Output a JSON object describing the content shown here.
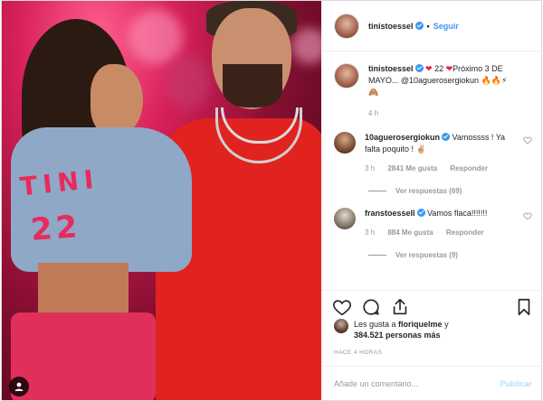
{
  "post": {
    "author": "tinistoessel",
    "follow_label": "Seguir",
    "separator": "•"
  },
  "caption": {
    "username": "tinistoessel",
    "text_before": " 22 ",
    "text_after": "Próximo 3 DE MAYO... @10aguerosergiokun 🔥🔥⚡",
    "emoji_line": "🙈",
    "time": "4 h"
  },
  "comments": [
    {
      "username": "10aguerosergiokun",
      "text": " Vamossss ! Ya falta poquito ! ✌🏼",
      "time": "3 h",
      "likes": "2841 Me gusta",
      "reply_label": "Responder",
      "replies": "Ver respuestas (69)"
    },
    {
      "username": "franstoessell",
      "text": " Vamos flaca!!!!!!!",
      "time": "3 h",
      "likes": "884 Me gusta",
      "reply_label": "Responder",
      "replies": "Ver respuestas (9)"
    }
  ],
  "likes": {
    "prefix": "Les gusta a ",
    "user": "floriquelme",
    "middle": " y ",
    "count": "384.521 personas más"
  },
  "timestamp": "HACE 4 HORAS",
  "add_comment": {
    "placeholder": "Añade un comentario...",
    "publish_label": "Publicar"
  },
  "photo": {
    "jacket_text": "TINI",
    "jacket_number": "22"
  },
  "colors": {
    "accent": "#3897f0",
    "heart": "#ed1c3f",
    "publish_disabled": "#b2dffc"
  },
  "icons": [
    "verified-icon",
    "heart-icon",
    "comment-icon",
    "share-icon",
    "bookmark-icon",
    "user-tag-icon"
  ]
}
